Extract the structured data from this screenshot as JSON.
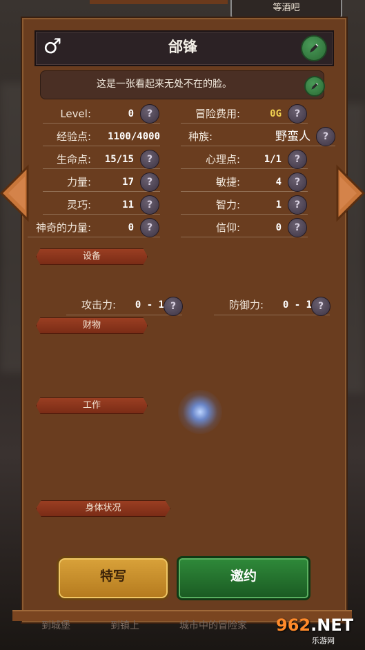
{
  "top_tab": "等酒吧",
  "hero": {
    "name": "郃锋",
    "gender_symbol": "♂"
  },
  "description": "这是一张看起来无处不在的脸。",
  "stats_left": [
    {
      "label": "Level:",
      "value": "0"
    },
    {
      "label": "经验点:",
      "value": "1100/4000"
    },
    {
      "label": "生命点:",
      "value": "15/15"
    },
    {
      "label": "力量:",
      "value": "17"
    },
    {
      "label": "灵巧:",
      "value": "11"
    },
    {
      "label": "神奇的力量:",
      "value": "0"
    }
  ],
  "stats_right": [
    {
      "label": "冒险费用:",
      "value": "0G"
    },
    {
      "label": "种族:",
      "value": "野蛮人"
    },
    {
      "label": "心理点:",
      "value": "1/1"
    },
    {
      "label": "敏捷:",
      "value": "4"
    },
    {
      "label": "智力:",
      "value": "1"
    },
    {
      "label": "信仰:",
      "value": "0"
    }
  ],
  "sections": {
    "equipment": "设备",
    "property": "财物",
    "job": "工作",
    "body_status": "身体状况"
  },
  "combat": {
    "attack_label": "攻击力:",
    "attack_value": "0 - 1",
    "defense_label": "防御力:",
    "defense_value": "0 - 1"
  },
  "help_glyph": "?",
  "buttons": {
    "feature": "特写",
    "invite": "邀约"
  },
  "bottom_nav": [
    "到城堡",
    "到镇上",
    "城市中的冒险家"
  ],
  "watermark": {
    "main_a": "9",
    "main_b": "6",
    "main_c": "2",
    "main_d": ".NET",
    "sub": "乐游网"
  },
  "colors": {
    "panel": "#6a3d1f",
    "gold_value": "#f0d050",
    "invite_green": "#2f8a3a",
    "feature_gold": "#d9a23a"
  }
}
